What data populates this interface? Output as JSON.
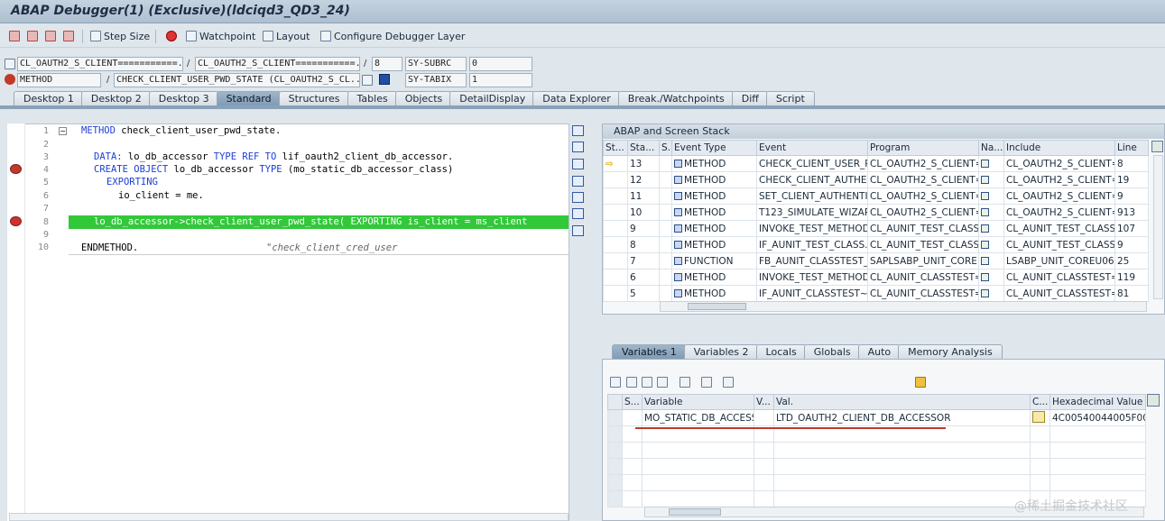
{
  "window": {
    "title": "ABAP Debugger(1)  (Exclusive)(ldciqd3_QD3_24)"
  },
  "toolbar": {
    "step_size": "Step Size",
    "watchpoint": "Watchpoint",
    "layout": "Layout",
    "configure": "Configure Debugger Layer"
  },
  "info": {
    "program1": "CL_OAUTH2_S_CLIENT===========.",
    "program2": "CL_OAUTH2_S_CLIENT===========.",
    "line_no": "8",
    "subrc_label": "SY-SUBRC",
    "subrc_value": "0",
    "type": "METHOD",
    "method": "CHECK_CLIENT_USER_PWD_STATE (CL_OAUTH2_S_CL...",
    "tabix_label": "SY-TABIX",
    "tabix_value": "1"
  },
  "tabs": [
    "Desktop 1",
    "Desktop 2",
    "Desktop 3",
    "Standard",
    "Structures",
    "Tables",
    "Objects",
    "DetailDisplay",
    "Data Explorer",
    "Break./Watchpoints",
    "Diff",
    "Script"
  ],
  "active_tab": "Standard",
  "code": {
    "line_numbers": [
      "1",
      "2",
      "3",
      "4",
      "5",
      "6",
      "7",
      "8",
      "9",
      "10"
    ],
    "l1_kw": "METHOD",
    "l1_rest": " check_client_user_pwd_state.",
    "l3_kw": "DATA:",
    "l3_a": " lo_db_accessor ",
    "l3_kw2": "TYPE REF TO",
    "l3_b": " lif_oauth2_client_db_accessor.",
    "l4_kw": "CREATE OBJECT",
    "l4_a": " lo_db_accessor ",
    "l4_kw2": "TYPE",
    "l4_b": " (mo_static_db_accessor_class)",
    "l5_kw": "EXPORTING",
    "l6": "io_client = me.",
    "l8": "lo_db_accessor->check_client_user_pwd_state( EXPORTING is_client = ms_client",
    "l10_kw": "ENDMETHOD.",
    "l10_cm": "\"check_client_cred_user"
  },
  "stack": {
    "title": "ABAP and Screen Stack",
    "headers": [
      "St...",
      "Sta...",
      "S...",
      "Event Type",
      "Event",
      "Program",
      "Na...",
      "Include",
      "Line"
    ],
    "rows": [
      {
        "level": "13",
        "type": "METHOD",
        "event": "CHECK_CLIENT_USER_P...",
        "program": "CL_OAUTH2_S_CLIENT=...",
        "include": "CL_OAUTH2_S_CLIENT=...",
        "line": "8",
        "blue": false
      },
      {
        "level": "12",
        "type": "METHOD",
        "event": "CHECK_CLIENT_AUTHEN...",
        "program": "CL_OAUTH2_S_CLIENT=...",
        "include": "CL_OAUTH2_S_CLIENT=...",
        "line": "19",
        "blue": false
      },
      {
        "level": "11",
        "type": "METHOD",
        "event": "SET_CLIENT_AUTHENTI...",
        "program": "CL_OAUTH2_S_CLIENT=...",
        "include": "CL_OAUTH2_S_CLIENT=...",
        "line": "9",
        "blue": false
      },
      {
        "level": "10",
        "type": "METHOD",
        "event": "T123_SIMULATE_WIZAR...",
        "program": "CL_OAUTH2_S_CLIENT=...",
        "include": "CL_OAUTH2_S_CLIENT=...",
        "line": "913",
        "blue": false
      },
      {
        "level": "9",
        "type": "METHOD",
        "event": "INVOKE_TEST_METHOD",
        "program": "CL_AUNIT_TEST_CLASS...",
        "include": "CL_AUNIT_TEST_CLASS...",
        "line": "107",
        "blue": true
      },
      {
        "level": "8",
        "type": "METHOD",
        "event": "IF_AUNIT_TEST_CLASS...",
        "program": "CL_AUNIT_TEST_CLASS...",
        "include": "CL_AUNIT_TEST_CLASS...",
        "line": "9",
        "blue": true
      },
      {
        "level": "7",
        "type": "FUNCTION",
        "event": "FB_AUNIT_CLASSTEST_...",
        "program": "SAPLSABP_UNIT_CORE",
        "include": "LSABP_UNIT_COREU06",
        "line": "25",
        "blue": true
      },
      {
        "level": "6",
        "type": "METHOD",
        "event": "INVOKE_TEST_METHOD",
        "program": "CL_AUNIT_CLASSTEST=...",
        "include": "CL_AUNIT_CLASSTEST=...",
        "line": "119",
        "blue": true
      },
      {
        "level": "5",
        "type": "METHOD",
        "event": "IF_AUNIT_CLASSTEST~...",
        "program": "CL_AUNIT_CLASSTEST=...",
        "include": "CL_AUNIT_CLASSTEST=...",
        "line": "81",
        "blue": true
      }
    ]
  },
  "var_tabs": [
    "Variables 1",
    "Variables 2",
    "Locals",
    "Globals",
    "Auto",
    "Memory Analysis"
  ],
  "variables": {
    "headers": [
      "S...",
      "Variable",
      "V...",
      "Val.",
      "C...",
      "Hexadecimal Value"
    ],
    "row": {
      "variable": "MO_STATIC_DB_ACCESS...",
      "value": "LTD_OAUTH2_CLIENT_DB_ACCESSOR",
      "hex": "4C00540044005F004F"
    }
  },
  "watermark": "@稀土掘金技术社区"
}
